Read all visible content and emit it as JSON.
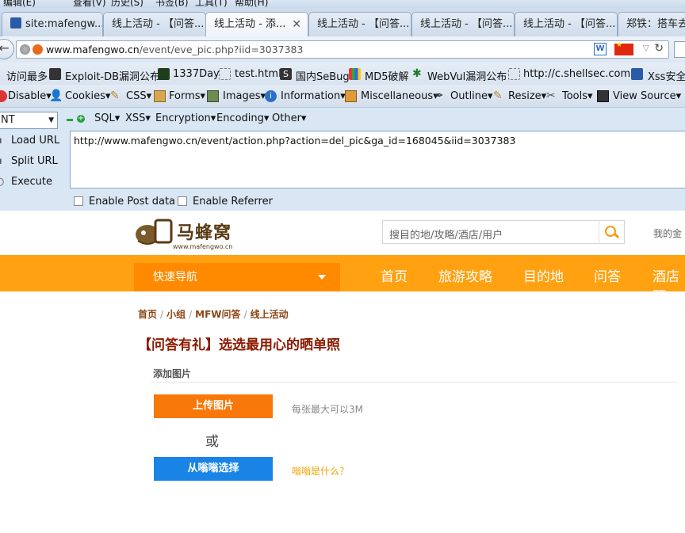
{
  "menu_bar": {
    "items": [
      "编辑(E)",
      "查看(V)",
      "历史(S)",
      "书签(B)",
      "工具(T)",
      "帮助(H)"
    ]
  },
  "tabs": [
    {
      "label": "site:mafengw...",
      "active": false,
      "icon": "baidu-paw-icon"
    },
    {
      "label": "线上活动 - 【问答...",
      "active": false
    },
    {
      "label": "线上活动 - 添...",
      "active": true
    },
    {
      "label": "线上活动 - 【问答...",
      "active": false
    },
    {
      "label": "线上活动 - 【问答...",
      "active": false
    },
    {
      "label": "线上活动 - 【问答...",
      "active": false
    },
    {
      "label": "郑铁：搭车去全...",
      "active": false
    }
  ],
  "address": {
    "domain": "www.mafengwo.cn",
    "path": "/event/eve_pic.php?iid=3037383"
  },
  "bookmarks": [
    "访问最多",
    "Exploit-DB漏洞公布",
    "1337Day",
    "test.html",
    "国内SeBug",
    "MD5破解",
    "WebVul漏洞公布",
    "http://c.shellsec.com...",
    "Xss安全"
  ],
  "webdev_toolbar": [
    "Disable▾",
    "Cookies▾",
    "CSS▾",
    "Forms▾",
    "Images▾",
    "Information▾",
    "Miscellaneous▾",
    "Outline▾",
    "Resize▾",
    "Tools▾",
    "View Source▾"
  ],
  "hackbar": {
    "select_value": "NT",
    "menus": [
      "SQL▾",
      "XSS▾",
      "Encryption▾",
      "Encoding▾",
      "Other▾"
    ],
    "actions": [
      "Load URL",
      "Split URL",
      "Execute"
    ],
    "url_value": "http://www.mafengwo.cn/event/action.php?action=del_pic&ga_id=168045&iid=3037383",
    "enable_post": "Enable Post data",
    "enable_referrer": "Enable Referrer"
  },
  "site": {
    "logo_text": "马蜂窝",
    "logo_sub": "www.mafengwo.cn",
    "search_placeholder": "搜目的地/攻略/酒店/用户",
    "login_text": "我的金",
    "quick_nav": "快速导航",
    "nav": [
      "首页",
      "旅游攻略",
      "目的地",
      "问答",
      "酒店预"
    ]
  },
  "page": {
    "breadcrumb": [
      "首页",
      "小组",
      "MFW问答",
      "线上活动"
    ],
    "title": "【问答有礼】选选最用心的晒单照",
    "section": "添加图片",
    "upload_button": "上传图片",
    "upload_hint": "每张最大可以3M",
    "or_text": "或",
    "choose_button": "从嗡嗡选择",
    "whatis_link": "嗡嗡是什么？"
  },
  "colors": {
    "accent_orange": "#ffa110",
    "upload_orange": "#f8780a",
    "choose_blue": "#1a84e6",
    "title_red": "#8b1a00"
  }
}
